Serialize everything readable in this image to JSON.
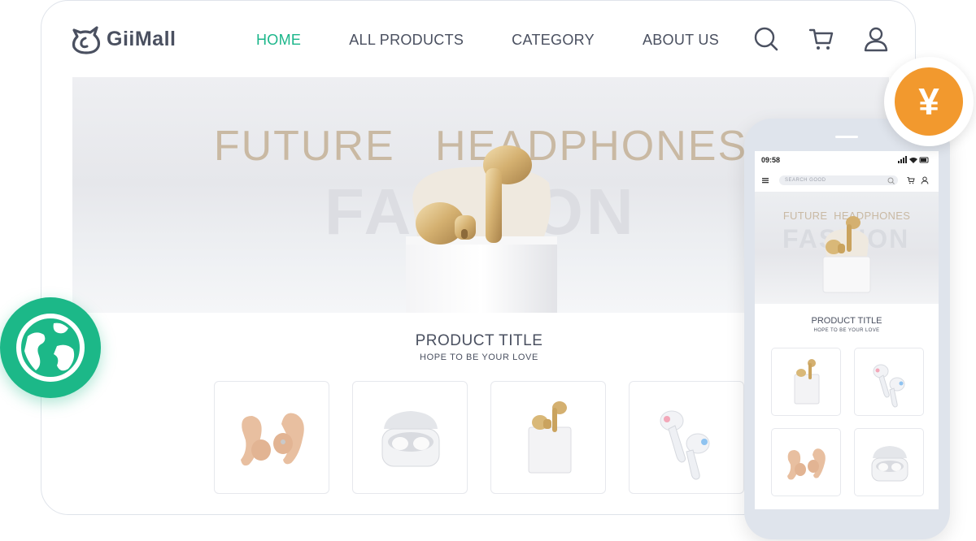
{
  "brand": {
    "name": "GiiMall",
    "logo_icon": "cat-face-logo"
  },
  "nav": {
    "items": [
      {
        "label": "HOME",
        "active": true
      },
      {
        "label": "ALL PRODUCTS",
        "active": false
      },
      {
        "label": "CATEGORY",
        "active": false
      },
      {
        "label": "ABOUT US",
        "active": false
      }
    ],
    "icons": [
      "search-icon",
      "cart-icon",
      "user-icon"
    ],
    "active_color": "#1bb68a"
  },
  "banner": {
    "title": "FUTURE   HEADPHONES",
    "subtitle": "FASHION"
  },
  "section": {
    "title": "PRODUCT TITLE",
    "subtitle": "HOPE TO BE YOUR LOVE"
  },
  "products": [
    {
      "name": "ear-hook-earbuds"
    },
    {
      "name": "white-earbuds-case"
    },
    {
      "name": "gold-earbuds-case"
    },
    {
      "name": "white-in-ear-earbuds"
    }
  ],
  "badges": {
    "globe": "globe-icon",
    "currency": "¥",
    "globe_color": "#1cb888",
    "currency_color": "#f2992e"
  },
  "mobile": {
    "time": "09:58",
    "search_placeholder": "SEARCH GOOD",
    "banner_title": "FUTURE  HEADPHONES",
    "banner_subtitle": "FASHION",
    "section_title": "PRODUCT TITLE",
    "section_subtitle": "HOPE TO BE YOUR LOVE"
  }
}
